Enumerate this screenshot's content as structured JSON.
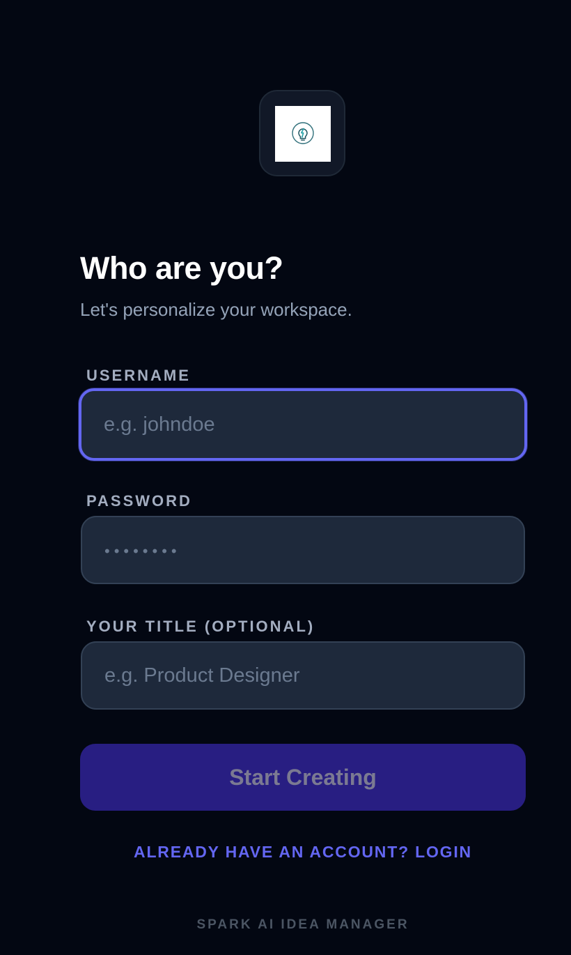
{
  "app": {
    "logo_icon": "lightbulb-bolt-icon",
    "accent_color": "#6366f1",
    "background_color": "#030712",
    "input_background": "#1e293b",
    "button_color": "#281e82"
  },
  "header": {
    "title": "Who are you?",
    "subtitle": "Let's personalize your workspace."
  },
  "form": {
    "username": {
      "label": "USERNAME",
      "value": "",
      "placeholder": "e.g. johndoe",
      "focused": true
    },
    "password": {
      "label": "PASSWORD",
      "value": "",
      "placeholder": "••••••••"
    },
    "title_field": {
      "label": "YOUR TITLE (OPTIONAL)",
      "value": "",
      "placeholder": "e.g. Product Designer"
    },
    "submit_label": "Start Creating"
  },
  "links": {
    "login": "ALREADY HAVE AN ACCOUNT? LOGIN"
  },
  "footer": {
    "text": "SPARK AI IDEA MANAGER"
  }
}
